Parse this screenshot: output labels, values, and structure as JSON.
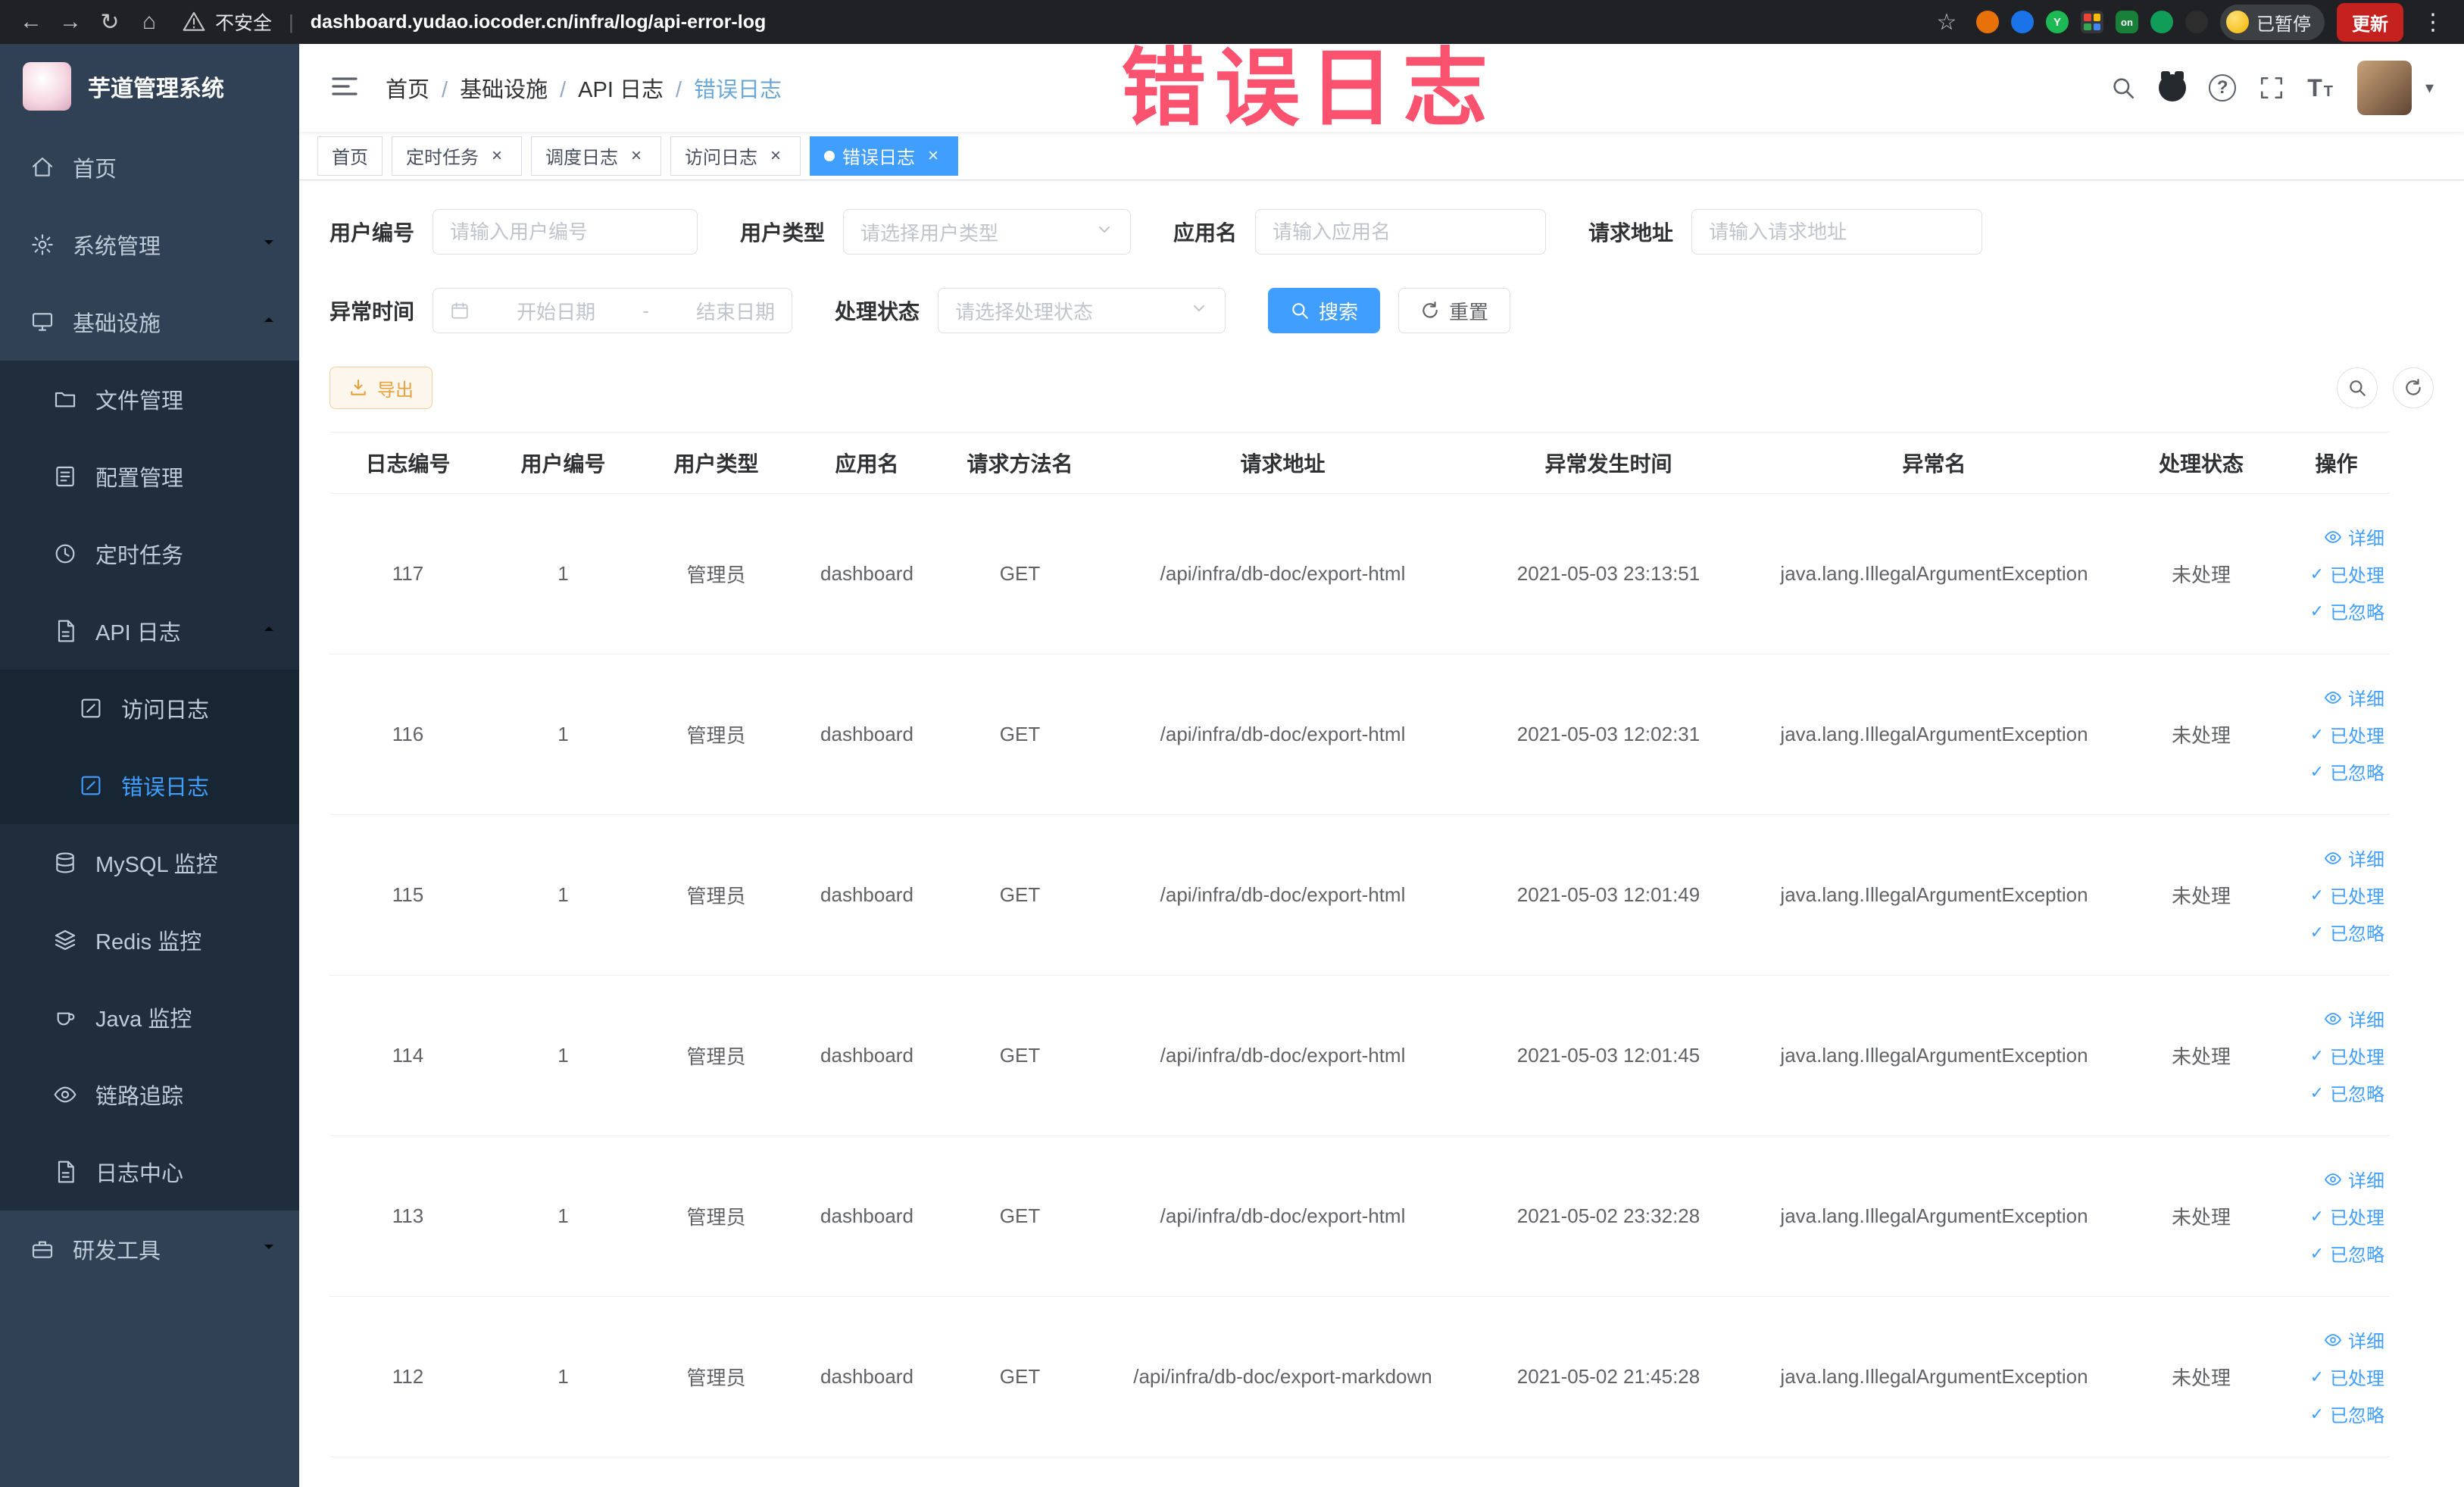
{
  "browser": {
    "security_label": "不安全",
    "url": "dashboard.yudao.iocoder.cn/infra/log/api-error-log",
    "paused_badge": "已暂停",
    "update_button": "更新"
  },
  "icons": {
    "back": "←",
    "forward": "→",
    "reload": "↻",
    "home": "⌂",
    "star": "☆",
    "kebab": "⋮",
    "caret_down": "▾",
    "close": "×",
    "check": "✓",
    "question": "?",
    "extension_on": "on"
  },
  "watermark": "错误日志",
  "sidebar": {
    "app_title": "芋道管理系统",
    "home": "首页",
    "system_management": "系统管理",
    "infrastructure": "基础设施",
    "file_management": "文件管理",
    "config_management": "配置管理",
    "scheduled_tasks": "定时任务",
    "api_logs": "API 日志",
    "access_log": "访问日志",
    "error_log": "错误日志",
    "mysql_monitor": "MySQL 监控",
    "redis_monitor": "Redis 监控",
    "java_monitor": "Java 监控",
    "tracing": "链路追踪",
    "log_center": "日志中心",
    "dev_tools": "研发工具"
  },
  "breadcrumb": [
    "首页",
    "基础设施",
    "API 日志",
    "错误日志"
  ],
  "tabs": [
    "首页",
    "定时任务",
    "调度日志",
    "访问日志",
    "错误日志"
  ],
  "filters": {
    "user_id_label": "用户编号",
    "user_id_placeholder": "请输入用户编号",
    "user_type_label": "用户类型",
    "user_type_placeholder": "请选择用户类型",
    "app_name_label": "应用名",
    "app_name_placeholder": "请输入应用名",
    "request_url_label": "请求地址",
    "request_url_placeholder": "请输入请求地址",
    "exception_time_label": "异常时间",
    "start_date_placeholder": "开始日期",
    "range_separator": "-",
    "end_date_placeholder": "结束日期",
    "process_status_label": "处理状态",
    "process_status_placeholder": "请选择处理状态",
    "search_button": "搜索",
    "reset_button": "重置"
  },
  "toolbar": {
    "export_button": "导出"
  },
  "table": {
    "headers": [
      "日志编号",
      "用户编号",
      "用户类型",
      "应用名",
      "请求方法名",
      "请求地址",
      "异常发生时间",
      "异常名",
      "处理状态",
      "操作"
    ],
    "rows": [
      [
        "117",
        "1",
        "管理员",
        "dashboard",
        "GET",
        "/api/infra/db-doc/export-html",
        "2021-05-03 23:13:51",
        "java.lang.IllegalArgumentException",
        "未处理"
      ],
      [
        "116",
        "1",
        "管理员",
        "dashboard",
        "GET",
        "/api/infra/db-doc/export-html",
        "2021-05-03 12:02:31",
        "java.lang.IllegalArgumentException",
        "未处理"
      ],
      [
        "115",
        "1",
        "管理员",
        "dashboard",
        "GET",
        "/api/infra/db-doc/export-html",
        "2021-05-03 12:01:49",
        "java.lang.IllegalArgumentException",
        "未处理"
      ],
      [
        "114",
        "1",
        "管理员",
        "dashboard",
        "GET",
        "/api/infra/db-doc/export-html",
        "2021-05-03 12:01:45",
        "java.lang.IllegalArgumentException",
        "未处理"
      ],
      [
        "113",
        "1",
        "管理员",
        "dashboard",
        "GET",
        "/api/infra/db-doc/export-html",
        "2021-05-02 23:32:28",
        "java.lang.IllegalArgumentException",
        "未处理"
      ],
      [
        "112",
        "1",
        "管理员",
        "dashboard",
        "GET",
        "/api/infra/db-doc/export-markdown",
        "2021-05-02 21:45:28",
        "java.lang.IllegalArgumentException",
        "未处理"
      ]
    ],
    "actions": {
      "detail": "详细",
      "processed": "已处理",
      "ignored": "已忽略"
    }
  },
  "colors": {
    "accent": "#409EFF",
    "warning": "#e6a23c",
    "watermark": "#fb3b5c",
    "sidebar_bg": "#304156",
    "submenu_bg": "#1f2d3d",
    "chrome_bg": "#202124"
  }
}
